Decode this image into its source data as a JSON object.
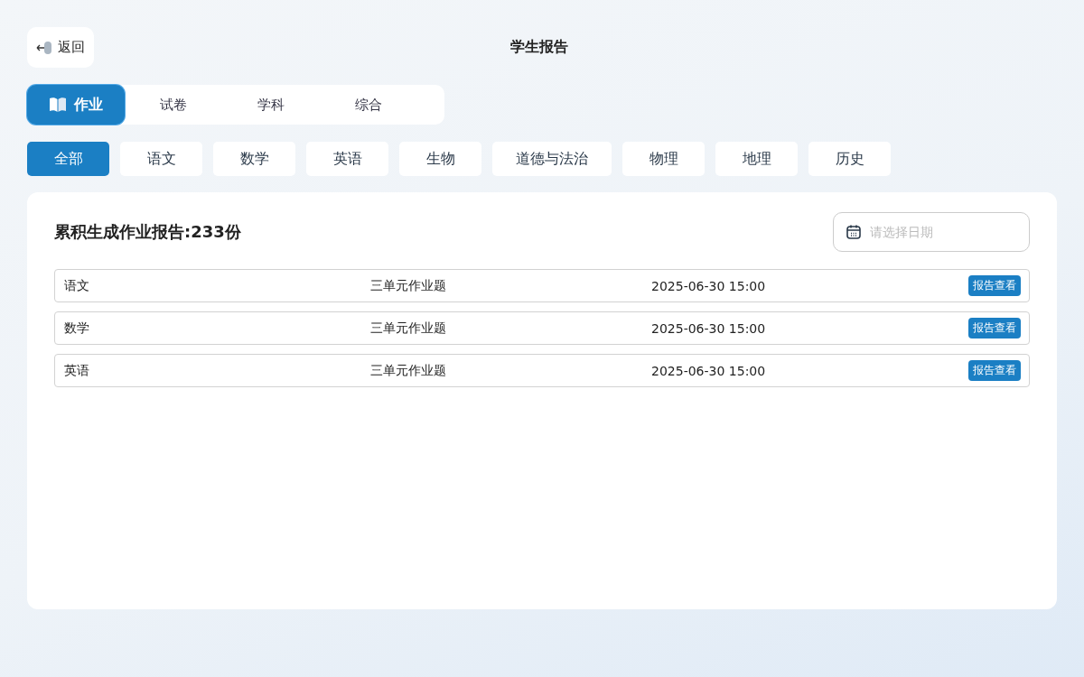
{
  "header": {
    "back_label": "返回",
    "title": "学生报告"
  },
  "tabs": [
    {
      "label": "作业",
      "selected": true
    },
    {
      "label": "试卷",
      "selected": false
    },
    {
      "label": "学科",
      "selected": false
    },
    {
      "label": "综合",
      "selected": false
    }
  ],
  "subjects": [
    {
      "label": "全部",
      "selected": true
    },
    {
      "label": "语文",
      "selected": false
    },
    {
      "label": "数学",
      "selected": false
    },
    {
      "label": "英语",
      "selected": false
    },
    {
      "label": "生物",
      "selected": false
    },
    {
      "label": "道德与法治",
      "selected": false
    },
    {
      "label": "物理",
      "selected": false
    },
    {
      "label": "地理",
      "selected": false
    },
    {
      "label": "历史",
      "selected": false
    }
  ],
  "summary": "累积生成作业报告:233份",
  "date_field": {
    "placeholder": "请选择日期"
  },
  "reports": [
    {
      "subject": "语文",
      "title": "三单元作业题",
      "time": "2025-06-30 15:00",
      "action": "报告查看"
    },
    {
      "subject": "数学",
      "title": "三单元作业题",
      "time": "2025-06-30 15:00",
      "action": "报告查看"
    },
    {
      "subject": "英语",
      "title": "三单元作业题",
      "time": "2025-06-30 15:00",
      "action": "报告查看"
    }
  ]
}
